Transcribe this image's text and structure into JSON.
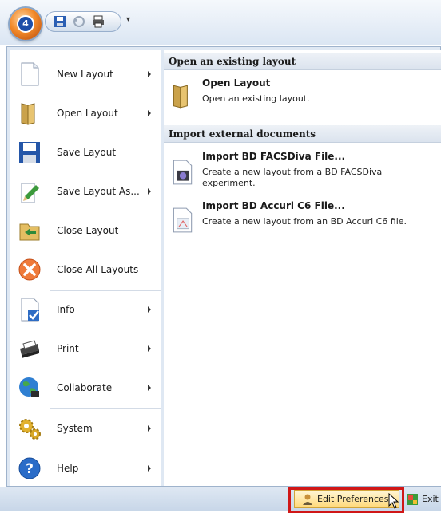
{
  "toolbar": {
    "app_orb_label": "4",
    "icons": [
      "save-icon",
      "undo-icon",
      "print-icon",
      "customize-dropdown-icon"
    ],
    "dropdown_glyph": "▾"
  },
  "menu": {
    "items": [
      {
        "label": "New Layout",
        "icon": "new-document-icon",
        "has_submenu": true
      },
      {
        "label": "Open Layout",
        "icon": "open-folder-icon",
        "has_submenu": true
      },
      {
        "label": "Save Layout",
        "icon": "save-disk-icon",
        "has_submenu": false
      },
      {
        "label": "Save Layout As...",
        "icon": "save-as-icon",
        "has_submenu": true
      },
      {
        "label": "Close Layout",
        "icon": "close-layout-icon",
        "has_submenu": false
      },
      {
        "label": "Close All Layouts",
        "icon": "close-all-icon",
        "has_submenu": false
      },
      {
        "label": "Info",
        "icon": "info-document-icon",
        "has_submenu": true
      },
      {
        "label": "Print",
        "icon": "printer-icon",
        "has_submenu": true
      },
      {
        "label": "Collaborate",
        "icon": "globe-icon",
        "has_submenu": true
      },
      {
        "label": "System",
        "icon": "gears-icon",
        "has_submenu": true
      },
      {
        "label": "Help",
        "icon": "help-icon",
        "has_submenu": true
      }
    ]
  },
  "panel": {
    "section_open": "Open an existing layout",
    "open_layout": {
      "title": "Open Layout",
      "desc": "Open an existing layout."
    },
    "section_import": "Import external documents",
    "import_facsdiva": {
      "title": "Import BD FACSDiva File...",
      "desc": "Create a new layout from a BD FACSDiva experiment."
    },
    "import_accuri": {
      "title": "Import BD Accuri C6 File...",
      "desc": "Create a new layout from an BD Accuri C6 file."
    }
  },
  "bottom": {
    "edit_preferences": "Edit Preferences",
    "exit": "Exit"
  },
  "colors": {
    "highlight_border": "#d01717",
    "panel_bg": "#dfe8f3",
    "button_hover": "#ffd97a"
  }
}
